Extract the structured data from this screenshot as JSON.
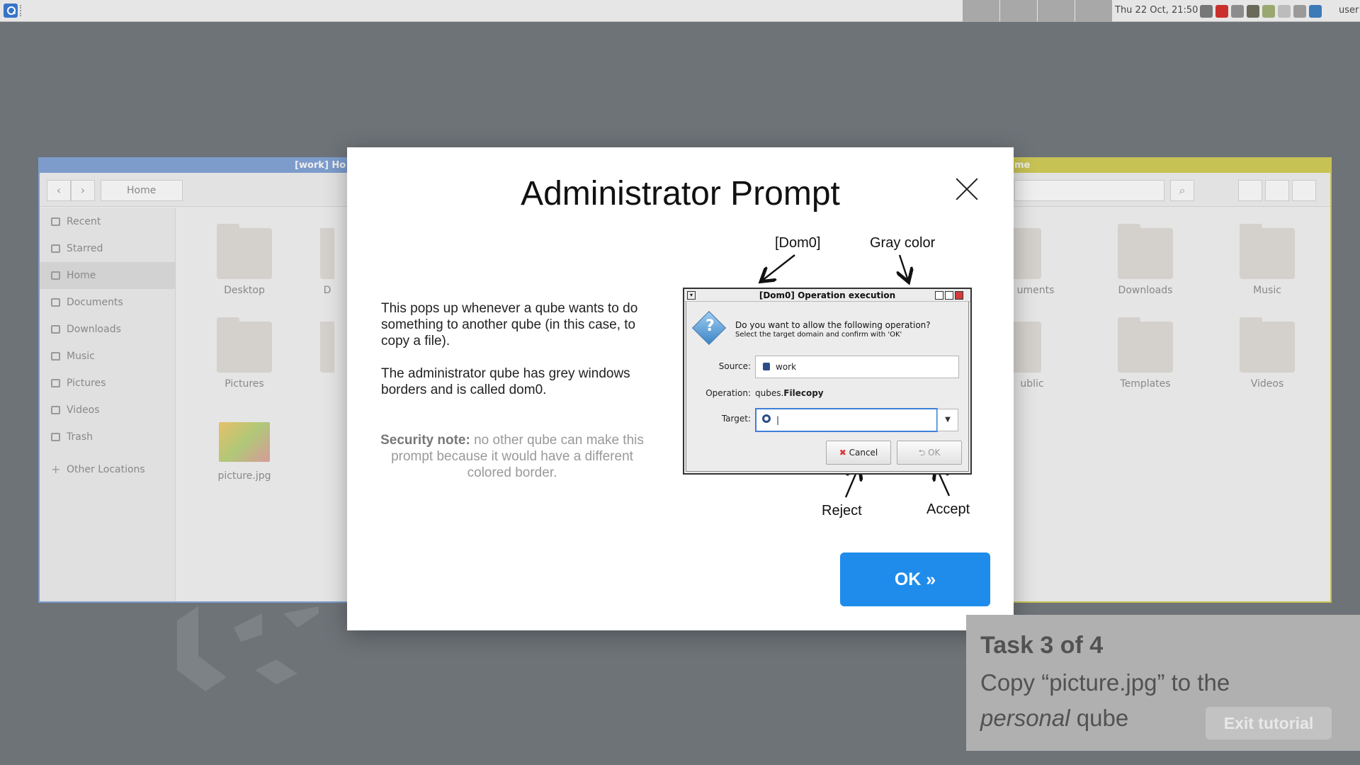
{
  "taskbar": {
    "clock": "Thu 22 Oct, 21:50",
    "user": "user",
    "tray_icons": [
      "volume-icon",
      "network-icon",
      "updates-icon",
      "devices-icon",
      "clipboard-icon",
      "disk-icon",
      "window-icon",
      "qubes-icon"
    ]
  },
  "work_window": {
    "title": "[work] Ho",
    "path": "Home",
    "sidebar": [
      "Recent",
      "Starred",
      "Home",
      "Documents",
      "Downloads",
      "Music",
      "Pictures",
      "Videos",
      "Trash",
      "Other Locations"
    ],
    "files": [
      "Desktop",
      "D",
      "Pictures",
      "picture.jpg"
    ]
  },
  "personal_window": {
    "title": "me",
    "files": [
      "uments",
      "Downloads",
      "Music",
      "ublic",
      "Templates",
      "Videos"
    ]
  },
  "modal": {
    "title": "Administrator Prompt",
    "paragraph1": "This pops up whenever a qube wants to do something to another qube (in this case, to copy a file).",
    "paragraph2": "The administrator qube has grey windows borders and is called dom0.",
    "security_label": "Security note:",
    "security_text": " no other qube can make this prompt because it would have a different colored border.",
    "annot_dom0": "[Dom0]",
    "annot_gray": "Gray color",
    "annot_reject": "Reject",
    "annot_accept": "Accept",
    "ok_label": "OK »"
  },
  "dialog": {
    "title": "[Dom0] Operation execution",
    "question": "Do you want to allow the following operation?",
    "hint": "Select the target domain and confirm with 'OK'",
    "source_label": "Source:",
    "source_value": "work",
    "operation_label": "Operation:",
    "operation_prefix": "qubes.",
    "operation_name": "Filecopy",
    "target_label": "Target:",
    "target_value": "|",
    "cancel_label": "Cancel",
    "ok_label": "OK"
  },
  "task": {
    "title": "Task 3 of 4",
    "line1": "Copy “picture.jpg” to the",
    "line2_em": "personal",
    "line2_rest": " qube",
    "exit_label": "Exit tutorial"
  },
  "colors": {
    "work_border": "#7d9ccc",
    "personal_border": "#c7c254",
    "accent": "#1f8ceb"
  }
}
